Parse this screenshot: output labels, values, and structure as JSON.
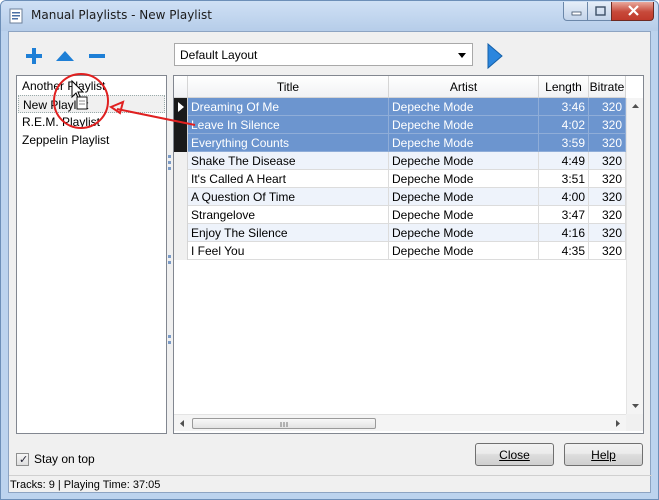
{
  "window": {
    "title": "Manual Playlists - New Playlist"
  },
  "toolbar": {
    "add_icon": "plus-icon",
    "move_up_icon": "triangle-up-icon",
    "remove_icon": "minus-icon",
    "layout_value": "Default Layout",
    "play_icon": "play-arrow-icon",
    "accent_color": "#1e7fd6"
  },
  "playlists": [
    {
      "label": "Another Playlist"
    },
    {
      "label": "New Playlist"
    },
    {
      "label": "R.E.M. Playlist"
    },
    {
      "label": "Zeppelin Playlist"
    }
  ],
  "grid": {
    "columns": [
      "Title",
      "Artist",
      "Length",
      "Bitrate"
    ],
    "rows": [
      {
        "title": "Dreaming Of Me",
        "artist": "Depeche Mode",
        "length": "3:46",
        "bitrate": "320"
      },
      {
        "title": "Leave In Silence",
        "artist": "Depeche Mode",
        "length": "4:02",
        "bitrate": "320"
      },
      {
        "title": "Everything Counts",
        "artist": "Depeche Mode",
        "length": "3:59",
        "bitrate": "320"
      },
      {
        "title": "Shake The Disease",
        "artist": "Depeche Mode",
        "length": "4:49",
        "bitrate": "320"
      },
      {
        "title": "It's Called A Heart",
        "artist": "Depeche Mode",
        "length": "3:51",
        "bitrate": "320"
      },
      {
        "title": "A Question Of Time",
        "artist": "Depeche Mode",
        "length": "4:00",
        "bitrate": "320"
      },
      {
        "title": "Strangelove",
        "artist": "Depeche Mode",
        "length": "3:47",
        "bitrate": "320"
      },
      {
        "title": "Enjoy The Silence",
        "artist": "Depeche Mode",
        "length": "4:16",
        "bitrate": "320"
      },
      {
        "title": "I Feel You",
        "artist": "Depeche Mode",
        "length": "4:35",
        "bitrate": "320"
      }
    ],
    "selection_color": "#6c95cf"
  },
  "footer": {
    "stay_on_top_label": "Stay on top",
    "stay_on_top_checked": true,
    "close_label": "Close",
    "help_label": "Help"
  },
  "status": {
    "text": "Tracks: 9  |  Playing Time: 37:05"
  },
  "annotation": {
    "color": "#e02020"
  }
}
